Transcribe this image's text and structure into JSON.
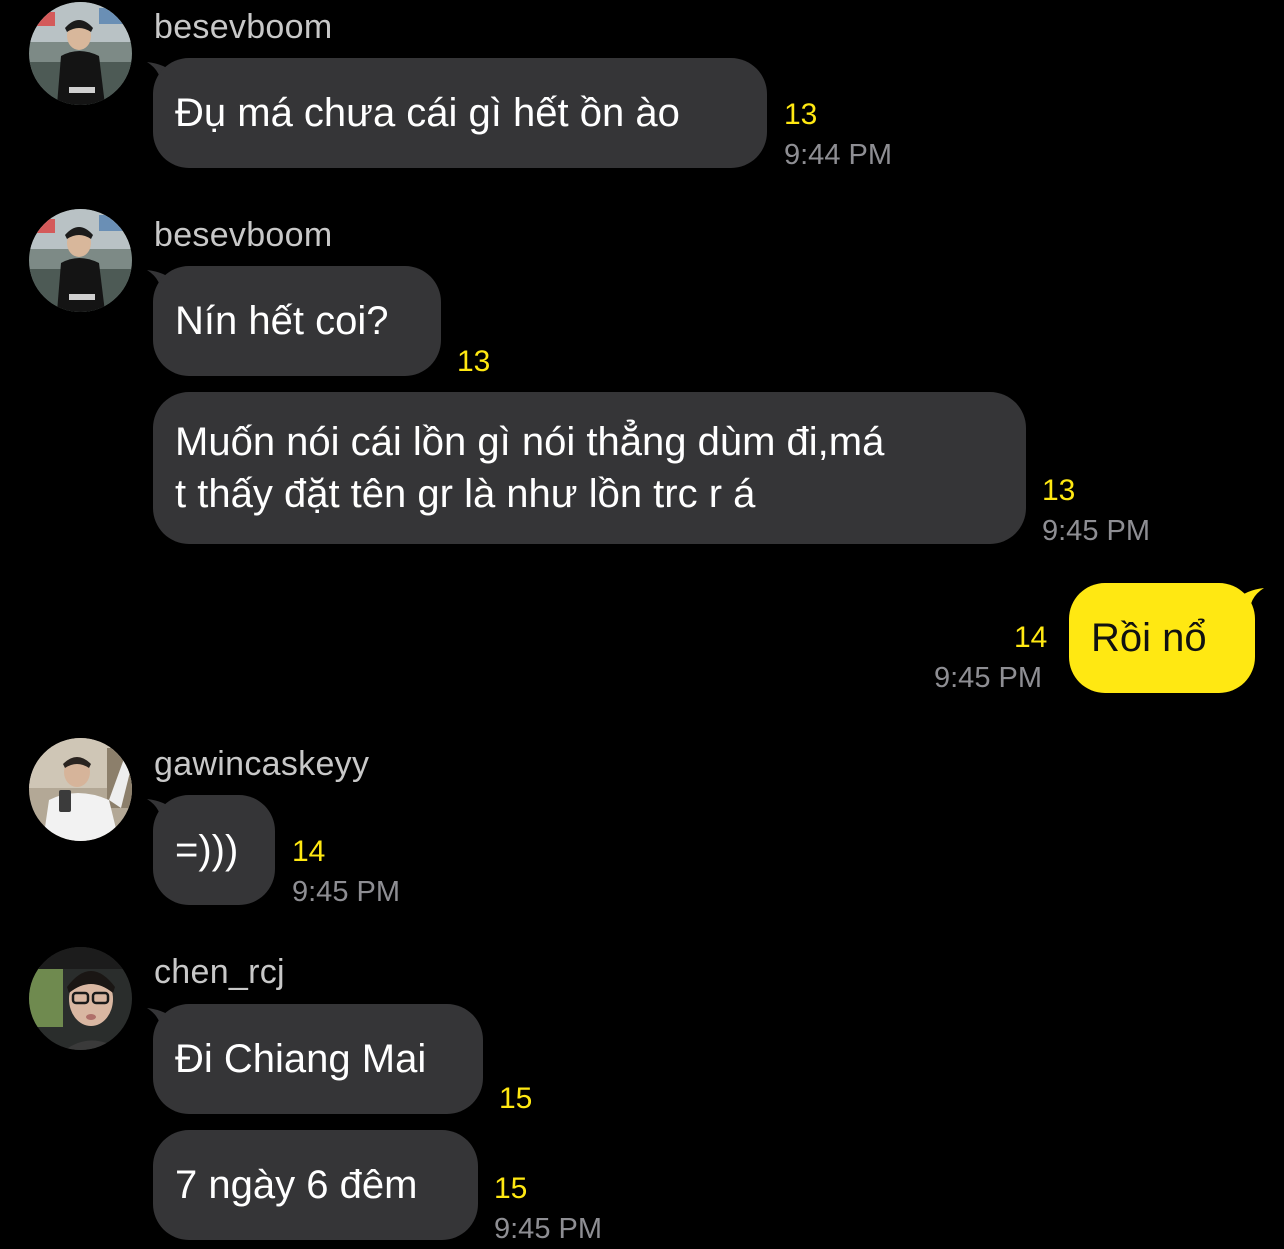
{
  "chat": {
    "messages": [
      {
        "sender": "besevboom",
        "text": "Đụ má chưa cái gì hết ồn ào",
        "unread": "13",
        "time": "9:44 PM"
      },
      {
        "sender": "besevboom",
        "text": "Nín hết coi?",
        "unread": "13"
      },
      {
        "text": "Muốn nói cái lồn gì nói thẳng dùm đi,má t thấy đặt tên gr là như lồn trc r á",
        "line1": "Muốn nói cái lồn gì nói thẳng dùm đi,má",
        "line2": "t thấy đặt tên gr là như lồn trc r á",
        "unread": "13",
        "time": "9:45 PM"
      },
      {
        "mine": true,
        "text": "Rồi nổ",
        "unread": "14",
        "time": "9:45 PM"
      },
      {
        "sender": "gawincaskeyy",
        "text": "=)))",
        "unread": "14",
        "time": "9:45 PM"
      },
      {
        "sender": "chen_rcj",
        "text": "Đi Chiang Mai",
        "unread": "15"
      },
      {
        "text": "7 ngày 6 đêm",
        "unread": "15",
        "time": "9:45 PM"
      }
    ]
  },
  "colors": {
    "background": "#000000",
    "incoming_bubble": "#353537",
    "outgoing_bubble": "#ffe812",
    "unread_count": "#ffe812",
    "timestamp": "#8e8e93",
    "sender_name": "#c8c8c8"
  },
  "icons": {
    "avatar_besevboom": "profile-photo",
    "avatar_gawincaskeyy": "profile-photo",
    "avatar_chen_rcj": "profile-photo"
  }
}
